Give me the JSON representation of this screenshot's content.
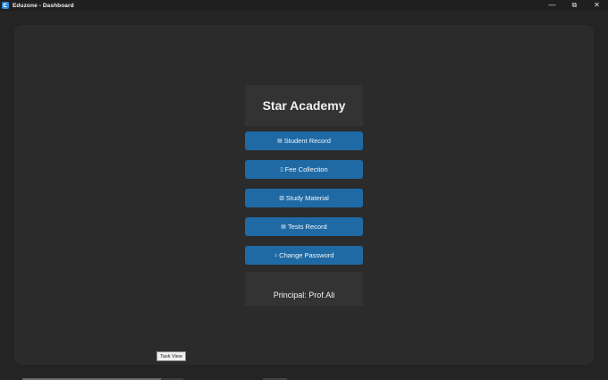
{
  "window": {
    "title": "Eduzone - Dashboard",
    "controls": {
      "minimize": "—",
      "restore": "⧉",
      "close": "✕"
    }
  },
  "header": {
    "school_name": "Star Academy"
  },
  "menu": [
    {
      "label": "Student Record",
      "icon": "clipboard-icon",
      "glyph": "▤"
    },
    {
      "label": "Fee Collection",
      "icon": "money-icon",
      "glyph": "▯"
    },
    {
      "label": "Study Material",
      "icon": "book-icon",
      "glyph": "▥"
    },
    {
      "label": "Tests Record",
      "icon": "notes-icon",
      "glyph": "▤"
    },
    {
      "label": "Change Password",
      "icon": "lock-icon",
      "glyph": "⌂"
    }
  ],
  "footer": {
    "principal": "Principal: Prof.Ali"
  },
  "tooltip": {
    "text": "Task View"
  },
  "colors": {
    "button": "#1f6aa5",
    "panel": "#2b2b2b",
    "card": "#333333",
    "app_icon": "#2f8cd8"
  }
}
